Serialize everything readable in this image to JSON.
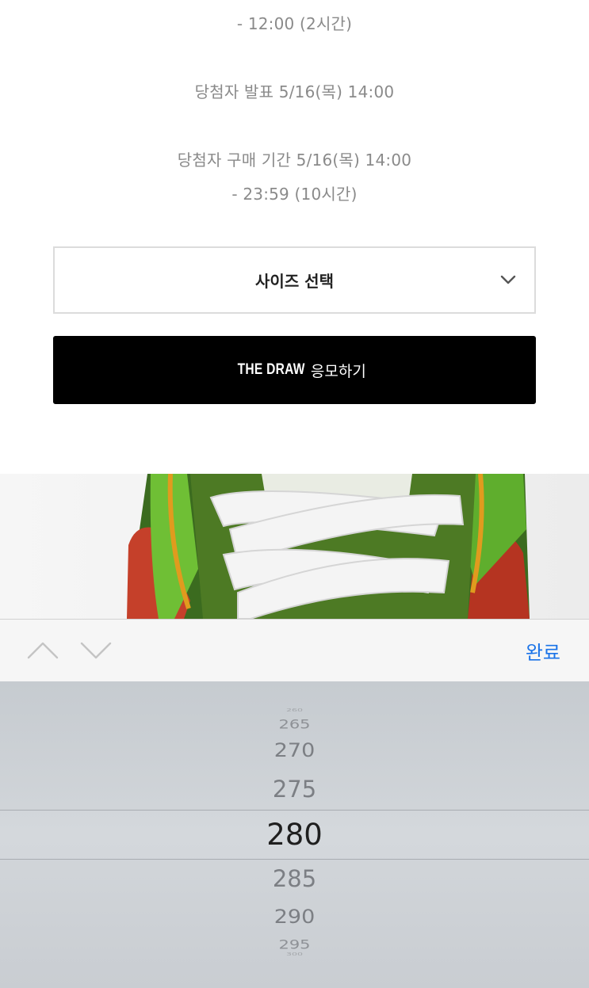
{
  "event_info": {
    "lines": [
      "- 12:00 (2시간)",
      "당첨자 발표 5/16(목) 14:00",
      "당첨자 구매 기간 5/16(목) 14:00",
      "- 23:59 (10시간)"
    ]
  },
  "size_select": {
    "label": "사이즈 선택",
    "icon": "chevron-down-icon"
  },
  "draw_button": {
    "brand": "THE DRAW",
    "label": "응모하기",
    "bg_color": "#000000"
  },
  "keyboard_toolbar": {
    "prev_icon": "chevron-up-icon",
    "next_icon": "chevron-down-icon",
    "done_label": "완료",
    "done_color": "#1a73e8"
  },
  "picker": {
    "options": [
      "260",
      "265",
      "270",
      "275",
      "280",
      "285",
      "290",
      "295",
      "300"
    ],
    "selected": "280"
  }
}
